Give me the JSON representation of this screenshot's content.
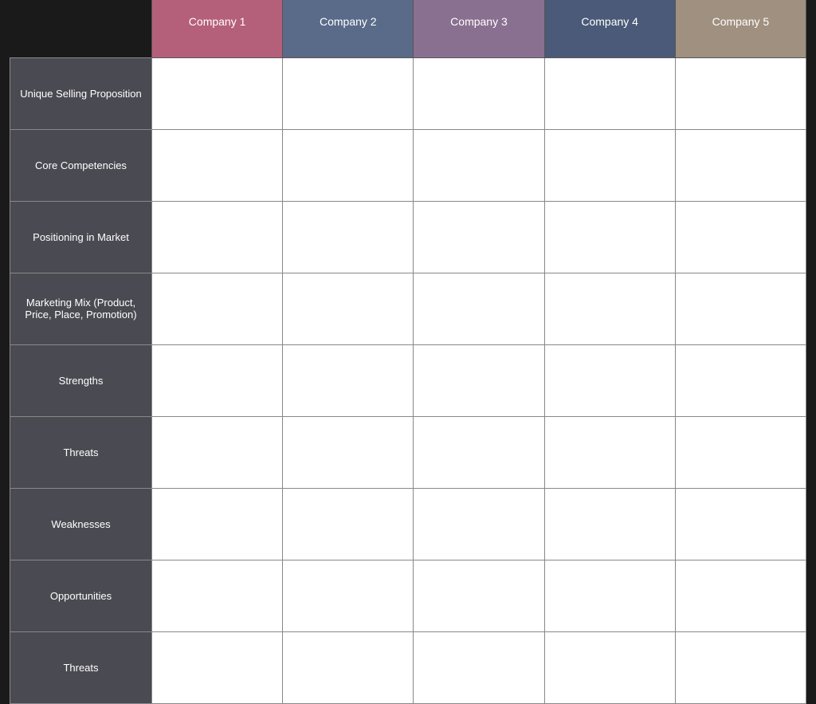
{
  "header": {
    "empty_label": "",
    "companies": [
      {
        "label": "Company 1",
        "class": "header-company1"
      },
      {
        "label": "Company 2",
        "class": "header-company2"
      },
      {
        "label": "Company 3",
        "class": "header-company3"
      },
      {
        "label": "Company 4",
        "class": "header-company4"
      },
      {
        "label": "Company 5",
        "class": "header-company5"
      }
    ]
  },
  "rows": [
    {
      "label": "Unique Selling Proposition"
    },
    {
      "label": "Core Competencies"
    },
    {
      "label": "Positioning in Market"
    },
    {
      "label": "Marketing Mix (Product, Price, Place, Promotion)"
    },
    {
      "label": "Strengths"
    },
    {
      "label": "Threats"
    },
    {
      "label": "Weaknesses"
    },
    {
      "label": "Opportunities"
    },
    {
      "label": "Threats"
    }
  ]
}
